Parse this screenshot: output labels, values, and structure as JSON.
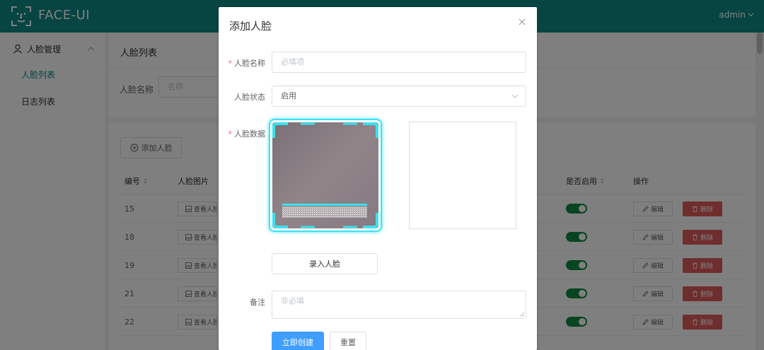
{
  "app": {
    "name": "FACE-UI",
    "user": "admin"
  },
  "sidebar": {
    "group_label": "人脸管理",
    "items": [
      {
        "label": "人脸列表",
        "active": true
      },
      {
        "label": "日志列表",
        "active": false
      }
    ]
  },
  "main": {
    "title": "人脸列表",
    "search": {
      "label": "人脸名称",
      "placeholder": "名称"
    },
    "add_button": "添加人脸",
    "columns": {
      "id": "编号",
      "image": "人脸图片",
      "enabled": "是否启用",
      "actions": "操作"
    },
    "rows": [
      {
        "id": "15",
        "view": "查看人脸",
        "enabled": true
      },
      {
        "id": "18",
        "view": "查看人脸",
        "enabled": true
      },
      {
        "id": "19",
        "view": "查看人脸",
        "enabled": true
      },
      {
        "id": "21",
        "view": "查看人脸",
        "enabled": true
      },
      {
        "id": "22",
        "view": "查看人脸",
        "enabled": true
      }
    ],
    "edit_label": "编辑",
    "delete_label": "删除"
  },
  "dialog": {
    "title": "添加人脸",
    "name_label": "人脸名称",
    "name_placeholder": "必填项",
    "status_label": "人脸状态",
    "status_value": "启用",
    "data_label": "人脸数据",
    "capture_button": "录入人脸",
    "remark_label": "备注",
    "remark_placeholder": "非必填",
    "submit_button": "立即创建",
    "reset_button": "重置"
  },
  "colors": {
    "brand": "#0e8b86",
    "primary": "#409eff",
    "danger": "#e05a5a",
    "switch_on": "#0e8b43",
    "scan": "#3be2ef"
  }
}
